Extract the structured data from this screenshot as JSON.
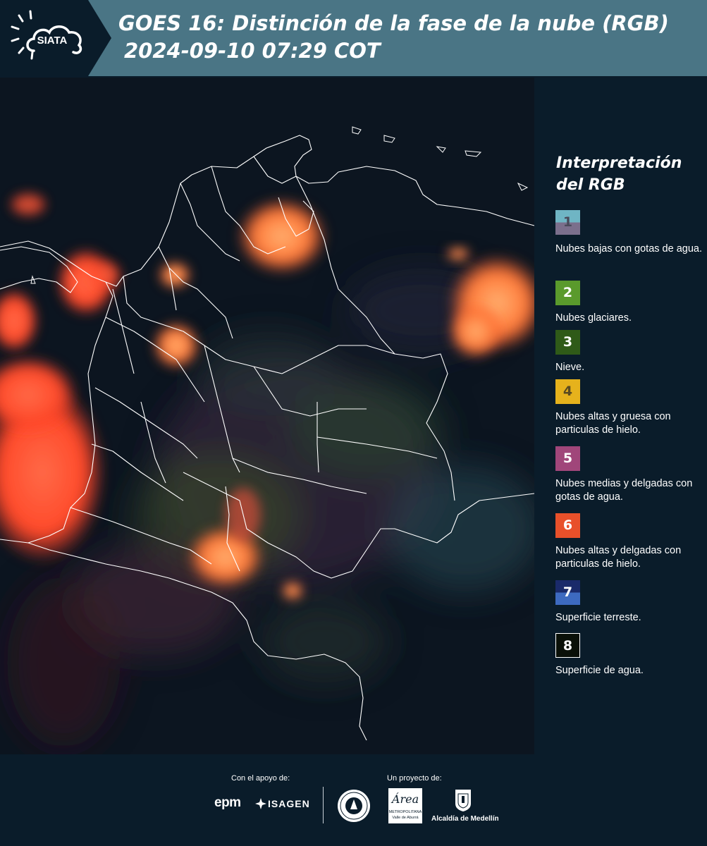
{
  "header": {
    "logo_text": "SIATA",
    "title_line1": "GOES 16: Distinción de la fase de la nube (RGB)",
    "title_line2": "2024-09-10 07:29 COT"
  },
  "legend": {
    "title_line1": "Interpretación",
    "title_line2": "del RGB",
    "items": [
      {
        "number": "1",
        "label": "Nubes bajas con gotas de agua.",
        "color_top": "#6fb5c4",
        "color_bottom": "#7b6f8c",
        "text_color": "#4a4a5a"
      },
      {
        "number": "2",
        "label": "Nubes glaciares.",
        "color_top": "#5a9a2c",
        "color_bottom": "#5a9a2c",
        "text_color": "#ffffff"
      },
      {
        "number": "3",
        "label": "Nieve.",
        "color_top": "#2f5a18",
        "color_bottom": "#2f5a18",
        "text_color": "#ffffff"
      },
      {
        "number": "4",
        "label": "Nubes altas y gruesa con particulas de hielo.",
        "color_top": "#e6b21c",
        "color_bottom": "#e6b21c",
        "text_color": "#5a4a20"
      },
      {
        "number": "5",
        "label": "Nubes medias y delgadas con gotas de agua.",
        "color_top": "#a0467a",
        "color_bottom": "#a0467a",
        "text_color": "#ffffff"
      },
      {
        "number": "6",
        "label": "Nubes altas y delgadas con particulas de hielo.",
        "color_top": "#e8502a",
        "color_bottom": "#e8502a",
        "text_color": "#ffffff"
      },
      {
        "number": "7",
        "label": "Superficie terreste.",
        "color_top": "#1a2a6a",
        "color_bottom": "#3d6ac0",
        "text_color": "#ffffff"
      },
      {
        "number": "8",
        "label": "Superficie de agua.",
        "color_top": "#0a1008",
        "color_bottom": "#0a1008",
        "text_color": "#ffffff"
      }
    ]
  },
  "footer": {
    "support_caption": "Con el apoyo de:",
    "project_caption": "Un proyecto de:",
    "logo_epm": "epm",
    "logo_isagen": "ISAGEN",
    "logo_metropolitana_script": "Área",
    "logo_metropolitana_line1": "METROPOLITANA",
    "logo_metropolitana_line2": "Valle de Aburrá",
    "logo_alcaldia": "Alcaldía de Medellín"
  },
  "colors": {
    "header_bg": "#4a7585",
    "logo_panel_bg": "#0a1c2a",
    "page_bg": "#0a1c2a",
    "cloud_red": "#ff4a2a",
    "cloud_orange": "#ff9a50",
    "border_line": "#ffffff"
  }
}
